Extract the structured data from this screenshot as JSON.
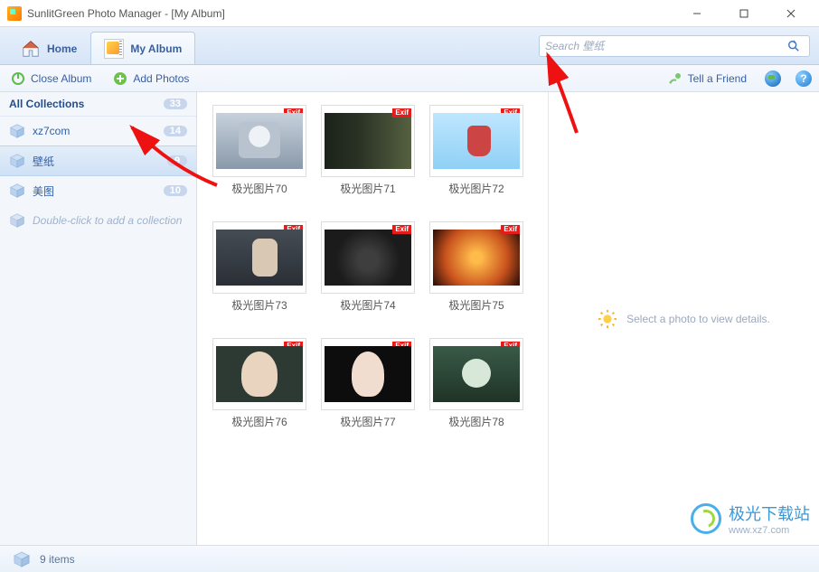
{
  "window": {
    "title": "SunlitGreen Photo Manager - [My Album]"
  },
  "tabs": {
    "home": "Home",
    "album": "My Album"
  },
  "search": {
    "placeholder": "Search 壁纸"
  },
  "toolbar": {
    "close_album": "Close Album",
    "add_photos": "Add Photos",
    "tell_friend": "Tell a Friend"
  },
  "sidebar": {
    "header": "All Collections",
    "header_count": "33",
    "items": [
      {
        "label": "xz7com",
        "count": "14",
        "selected": false
      },
      {
        "label": "壁纸",
        "count": "9",
        "selected": true
      },
      {
        "label": "美图",
        "count": "10",
        "selected": false
      }
    ],
    "add_hint": "Double-click to add a collection"
  },
  "thumbs": [
    {
      "name": "极光图片70",
      "cls": "img-a"
    },
    {
      "name": "极光图片71",
      "cls": "img-b"
    },
    {
      "name": "极光图片72",
      "cls": "img-c"
    },
    {
      "name": "极光图片73",
      "cls": "img-d"
    },
    {
      "name": "极光图片74",
      "cls": "img-e"
    },
    {
      "name": "极光图片75",
      "cls": "img-f"
    },
    {
      "name": "极光图片76",
      "cls": "img-g"
    },
    {
      "name": "极光图片77",
      "cls": "img-h"
    },
    {
      "name": "极光图片78",
      "cls": "img-i"
    }
  ],
  "exif_label": "Exif",
  "details": {
    "hint": "Select a photo to view details."
  },
  "status": {
    "text": "9 items"
  },
  "watermark": {
    "brand": "极光下载站",
    "url": "www.xz7.com"
  }
}
